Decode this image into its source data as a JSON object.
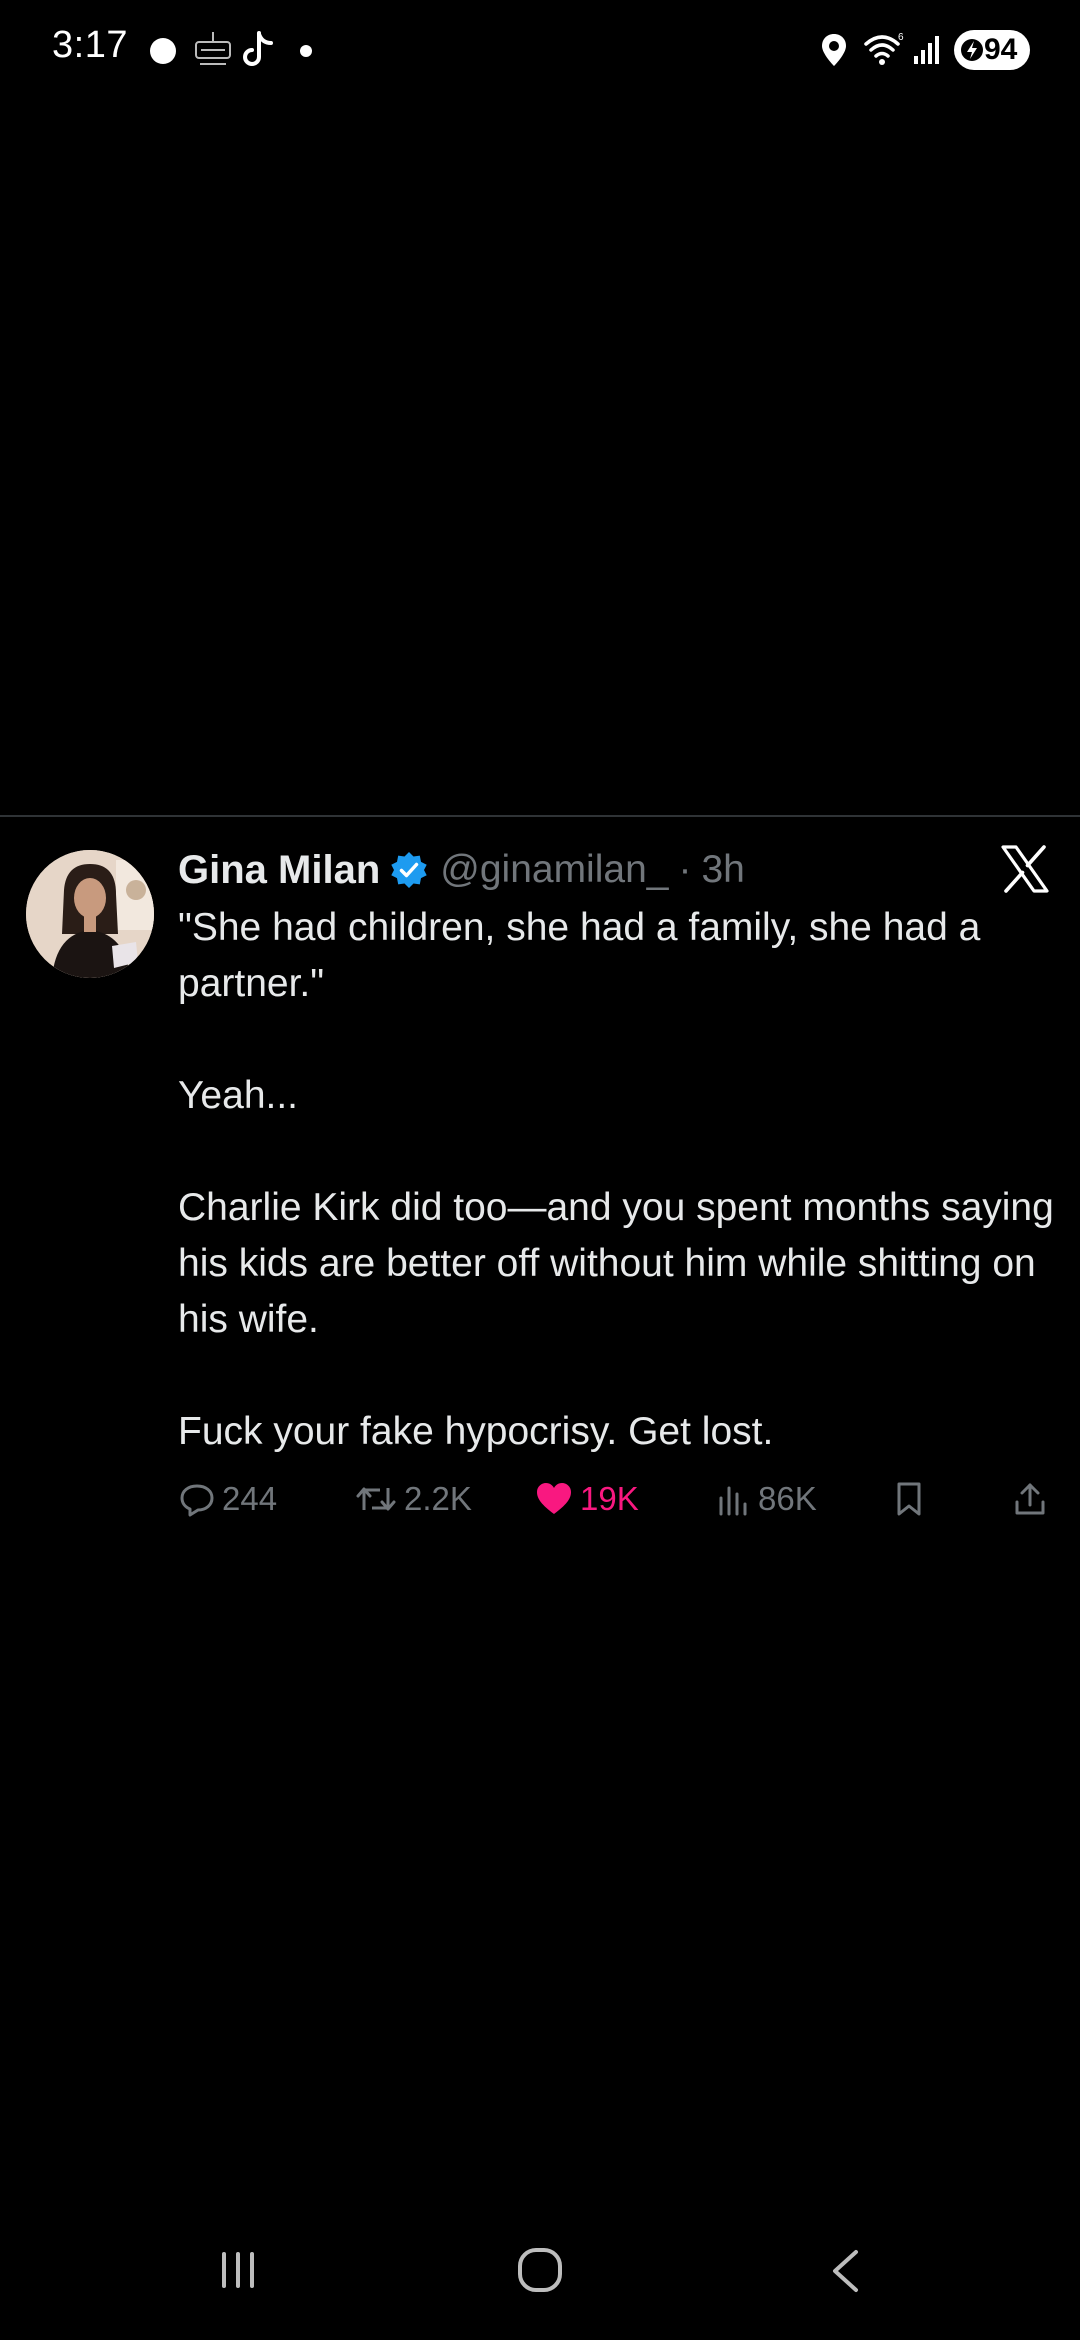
{
  "status_bar": {
    "time": "3:17",
    "battery": "94",
    "icons": [
      "notification-dot-icon",
      "app-badge-icon",
      "tiktok-icon",
      "small-dot-icon",
      "location-icon",
      "wifi-icon",
      "signal-icon",
      "battery-icon"
    ]
  },
  "tweet": {
    "display_name": "Gina Milan",
    "verified": true,
    "handle": "@ginamilan_",
    "separator": "·",
    "time_ago": "3h",
    "paragraphs": [
      "\"She had children, she had a family, she had a partner.\"",
      "Yeah...",
      "Charlie Kirk did too—and you spent months saying his kids are better off without him while shitting on his wife.",
      "Fuck your fake hypocrisy. Get lost."
    ],
    "stats": {
      "replies": "244",
      "reposts": "2.2K",
      "likes": "19K",
      "views": "86K"
    },
    "colors": {
      "like": "#f91880",
      "verified": "#1d9bf0",
      "muted": "#71767b",
      "text": "#e7e9ea",
      "background": "#000000"
    }
  },
  "nav_bar": {
    "icons": [
      "recents-icon",
      "home-icon",
      "back-icon"
    ]
  }
}
